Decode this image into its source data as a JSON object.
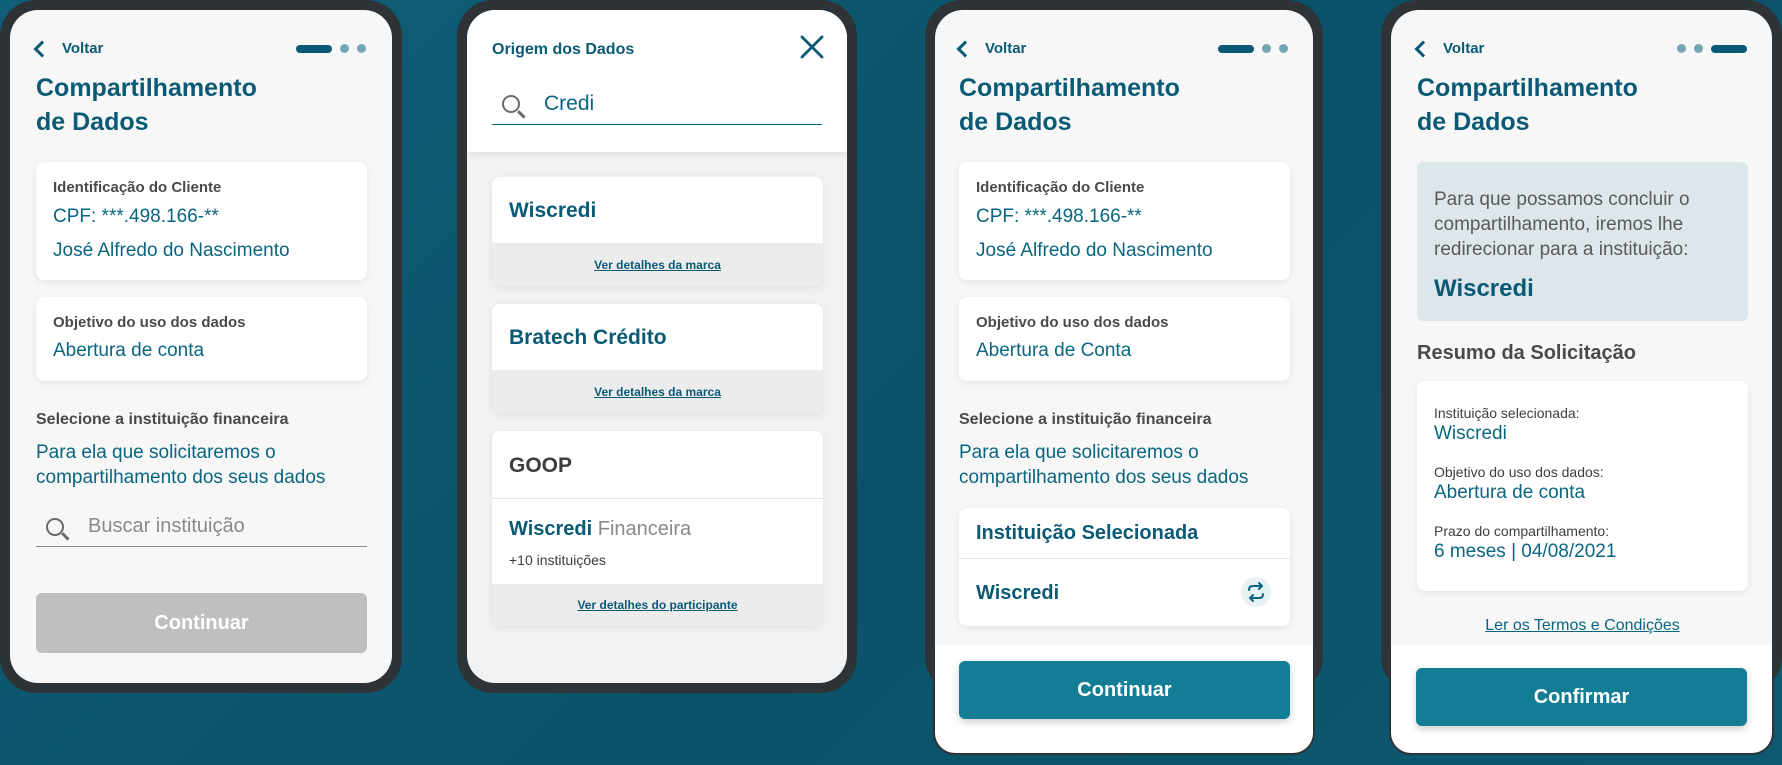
{
  "screen1": {
    "back": "Voltar",
    "title_line1": "Compartilhamento",
    "title_line2": "de Dados",
    "client_label": "Identificação do Cliente",
    "client_cpf": "CPF: ***.498.166-**",
    "client_name": "José Alfredo do Nascimento",
    "purpose_label": "Objetivo do uso dos dados",
    "purpose_value": "Abertura de conta",
    "select_title": "Selecione a instituição financeira",
    "select_info_line1": "Para ela que solicitaremos o",
    "select_info_line2": "compartilhamento dos seus dados",
    "search_placeholder": "Buscar instituição",
    "continue": "Continuar"
  },
  "screen2": {
    "title": "Origem dos Dados",
    "search_value": "Credi",
    "results": [
      {
        "name": "Wiscredi",
        "link": "Ver detalhes da marca"
      },
      {
        "name": "Bratech Crédito",
        "link": "Ver detalhes da marca"
      }
    ],
    "group": {
      "name": "GOOP",
      "brand_bold": "Wiscredi",
      "brand_light": " Financeira",
      "count": "+10 instituições",
      "link": "Ver detalhes do participante"
    }
  },
  "screen3": {
    "back": "Voltar",
    "title_line1": "Compartilhamento",
    "title_line2": "de Dados",
    "client_label": "Identificação do Cliente",
    "client_cpf": "CPF: ***.498.166-**",
    "client_name": "José Alfredo do Nascimento",
    "purpose_label": "Objetivo do uso dos dados",
    "purpose_value": "Abertura de Conta",
    "select_title": "Selecione a instituição financeira",
    "select_info_line1": "Para ela que solicitaremos o",
    "select_info_line2": "compartilhamento dos seus dados",
    "selected_title": "Instituição Selecionada",
    "selected_name": "Wiscredi",
    "continue": "Continuar"
  },
  "screen4": {
    "back": "Voltar",
    "title_line1": "Compartilhamento",
    "title_line2": "de Dados",
    "redirect_line1": "Para que possamos concluir o",
    "redirect_line2": "compartilhamento, iremos lhe",
    "redirect_line3": "redirecionar para a instituição:",
    "redirect_name": "Wiscredi",
    "summary_title": "Resumo da Solicitação",
    "inst_label": "Instituição selecionada:",
    "inst_value": "Wiscredi",
    "purpose_label": "Objetivo do uso dos dados:",
    "purpose_value": "Abertura de conta",
    "term_label": "Prazo do compartilhamento:",
    "term_value": "6 meses | 04/08/2021",
    "terms_link": "Ler os Termos e Condições",
    "confirm": "Confirmar"
  },
  "icons": {
    "back": "chevron-left-icon",
    "search": "search-icon",
    "close": "close-icon",
    "swap": "swap-icon"
  },
  "colors": {
    "background": "#0b5268",
    "primary": "#0a5a76",
    "button": "#147d96",
    "disabled": "#bfbfbf"
  }
}
